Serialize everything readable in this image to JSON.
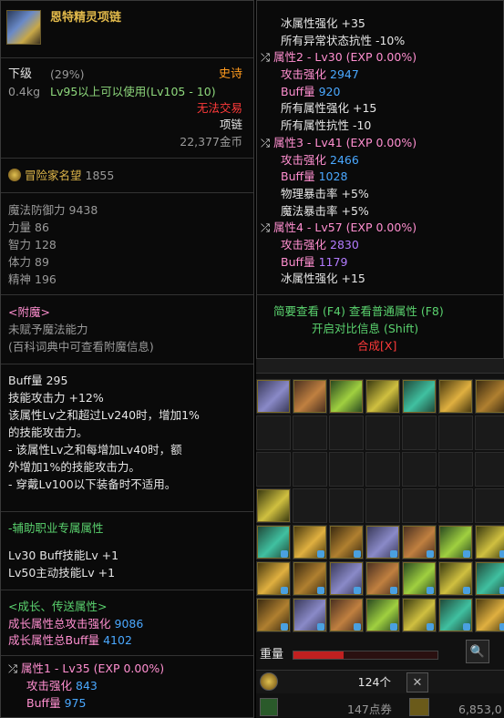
{
  "item": {
    "name": "恩特精灵项链",
    "grade": "下级",
    "grade_pct": "(29%)",
    "rarity": "史诗",
    "weight": "0.4kg",
    "level_req": "Lv95以上可以使用(Lv105 - 10)",
    "trade": "无法交易",
    "type": "项链",
    "price": "22,377金币"
  },
  "adventure": {
    "label": "冒险家名望",
    "value": "1855"
  },
  "stats": [
    {
      "name": "魔法防御力",
      "value": "9438"
    },
    {
      "name": "力量",
      "value": "86"
    },
    {
      "name": "智力",
      "value": "128"
    },
    {
      "name": "体力",
      "value": "89"
    },
    {
      "name": "精神",
      "value": "196"
    }
  ],
  "enchant": {
    "title": "<附魔>",
    "line1": "未赋予魔法能力",
    "line2": "(百科词典中可查看附魔信息)"
  },
  "buff": {
    "lines": [
      "Buff量 295",
      "技能攻击力 +12%",
      "该属性Lv之和超过Lv240时，增加1%",
      "的技能攻击力。",
      "- 该属性Lv之和每增加Lv40时，额",
      "外增加1%的技能攻击力。",
      "- 穿戴Lv100以下装备时不适用。"
    ]
  },
  "support": {
    "title": "-辅助职业专属属性",
    "line1": "Lv30 Buff技能Lv +1",
    "line2": "Lv50主动技能Lv +1"
  },
  "growth": {
    "title": "<成长、传送属性>",
    "atk_label": "成长属性总攻击强化",
    "atk_value": "9086",
    "buff_label": "成长属性总Buff量",
    "buff_value": "4102",
    "attr1_title": "属性1 - Lv35 (EXP 0.00%)",
    "attr1_atk_label": "攻击强化",
    "attr1_atk": "843",
    "attr1_buff_label": "Buff量",
    "attr1_buff": "975"
  },
  "right": {
    "line_ice": "冰属性强化 +35",
    "line_abn": "所有异常状态抗性 -10%",
    "attr2_title": "属性2 - Lv30 (EXP 0.00%)",
    "attr2_atk_label": "攻击强化",
    "attr2_atk": "2947",
    "attr2_buff_label": "Buff量",
    "attr2_buff": "920",
    "attr2_l1": "所有属性强化 +15",
    "attr2_l2": "所有属性抗性 -10",
    "attr3_title": "属性3 - Lv41 (EXP 0.00%)",
    "attr3_atk_label": "攻击强化",
    "attr3_atk": "2466",
    "attr3_buff_label": "Buff量",
    "attr3_buff": "1028",
    "attr3_l1": "物理暴击率 +5%",
    "attr3_l2": "魔法暴击率 +5%",
    "attr4_title": "属性4 - Lv57 (EXP 0.00%)",
    "attr4_atk_label": "攻击强化",
    "attr4_atk": "2830",
    "attr4_buff_label": "Buff量",
    "attr4_buff": "1179",
    "attr4_l1": "冰属性强化 +15",
    "hint1": "简要查看 (F4) 查看普通属性 (F8)",
    "hint2": "开启对比信息 (Shift)",
    "compose": "合成[X]"
  },
  "inventory": {
    "weight_label": "重量",
    "weight_fill": 0.35,
    "count": "124个",
    "points": "147点券",
    "gold": "6,853,0"
  },
  "colors": {
    "rarity": "#ff9a1e",
    "buff_blue": "#4aa8ff",
    "attr_purple": "#b37bff",
    "trade_red": "#ff3a3a",
    "hint_green": "#5ad26e"
  }
}
